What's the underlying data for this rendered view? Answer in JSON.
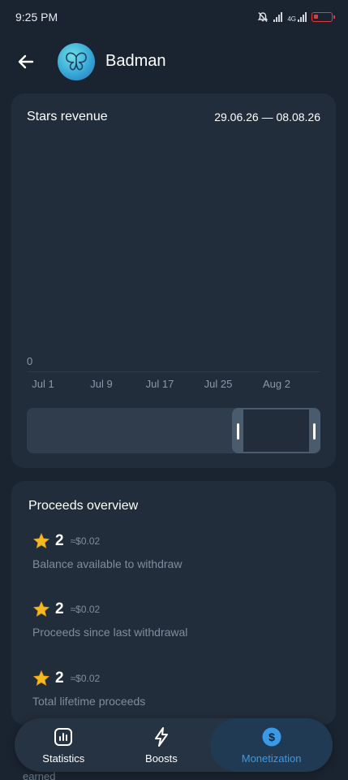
{
  "status_bar": {
    "time": "9:25 PM",
    "network_label": "4G",
    "battery_color": "#e03a3a",
    "icons": [
      "mute-icon",
      "signal-icon",
      "network-icon",
      "battery-icon"
    ]
  },
  "header": {
    "back_icon": "arrow-left-icon",
    "avatar_icon": "butterfly-icon",
    "channel_name": "Badman"
  },
  "chart": {
    "title": "Stars revenue",
    "date_range": "29.06.26 — 08.08.26",
    "chart_data": {
      "type": "line",
      "title": "Stars revenue",
      "y_tick_labels": [
        "0"
      ],
      "x_tick_labels": [
        "Jul 1",
        "Jul 9",
        "Jul 17",
        "Jul 25",
        "Aug 2"
      ],
      "series": [],
      "zoom_selection": [
        0.7,
        1.0
      ]
    }
  },
  "proceeds": {
    "title": "Proceeds overview",
    "items": [
      {
        "amount": "2",
        "usd": "≈$0.02",
        "label": "Balance available to withdraw"
      },
      {
        "amount": "2",
        "usd": "≈$0.02",
        "label": "Proceeds since last withdrawal"
      },
      {
        "amount": "2",
        "usd": "≈$0.02",
        "label": "Total lifetime proceeds"
      }
    ],
    "star_icon": "star-icon",
    "star_color": "#f5b91f"
  },
  "below_nav_text": "earned",
  "bottom_nav": {
    "items": [
      {
        "label": "Statistics",
        "icon": "bar-chart-icon",
        "active": false
      },
      {
        "label": "Boosts",
        "icon": "lightning-icon",
        "active": false
      },
      {
        "label": "Monetization",
        "icon": "dollar-coin-icon",
        "active": true
      }
    ],
    "accent_color": "#3a9ae8"
  }
}
